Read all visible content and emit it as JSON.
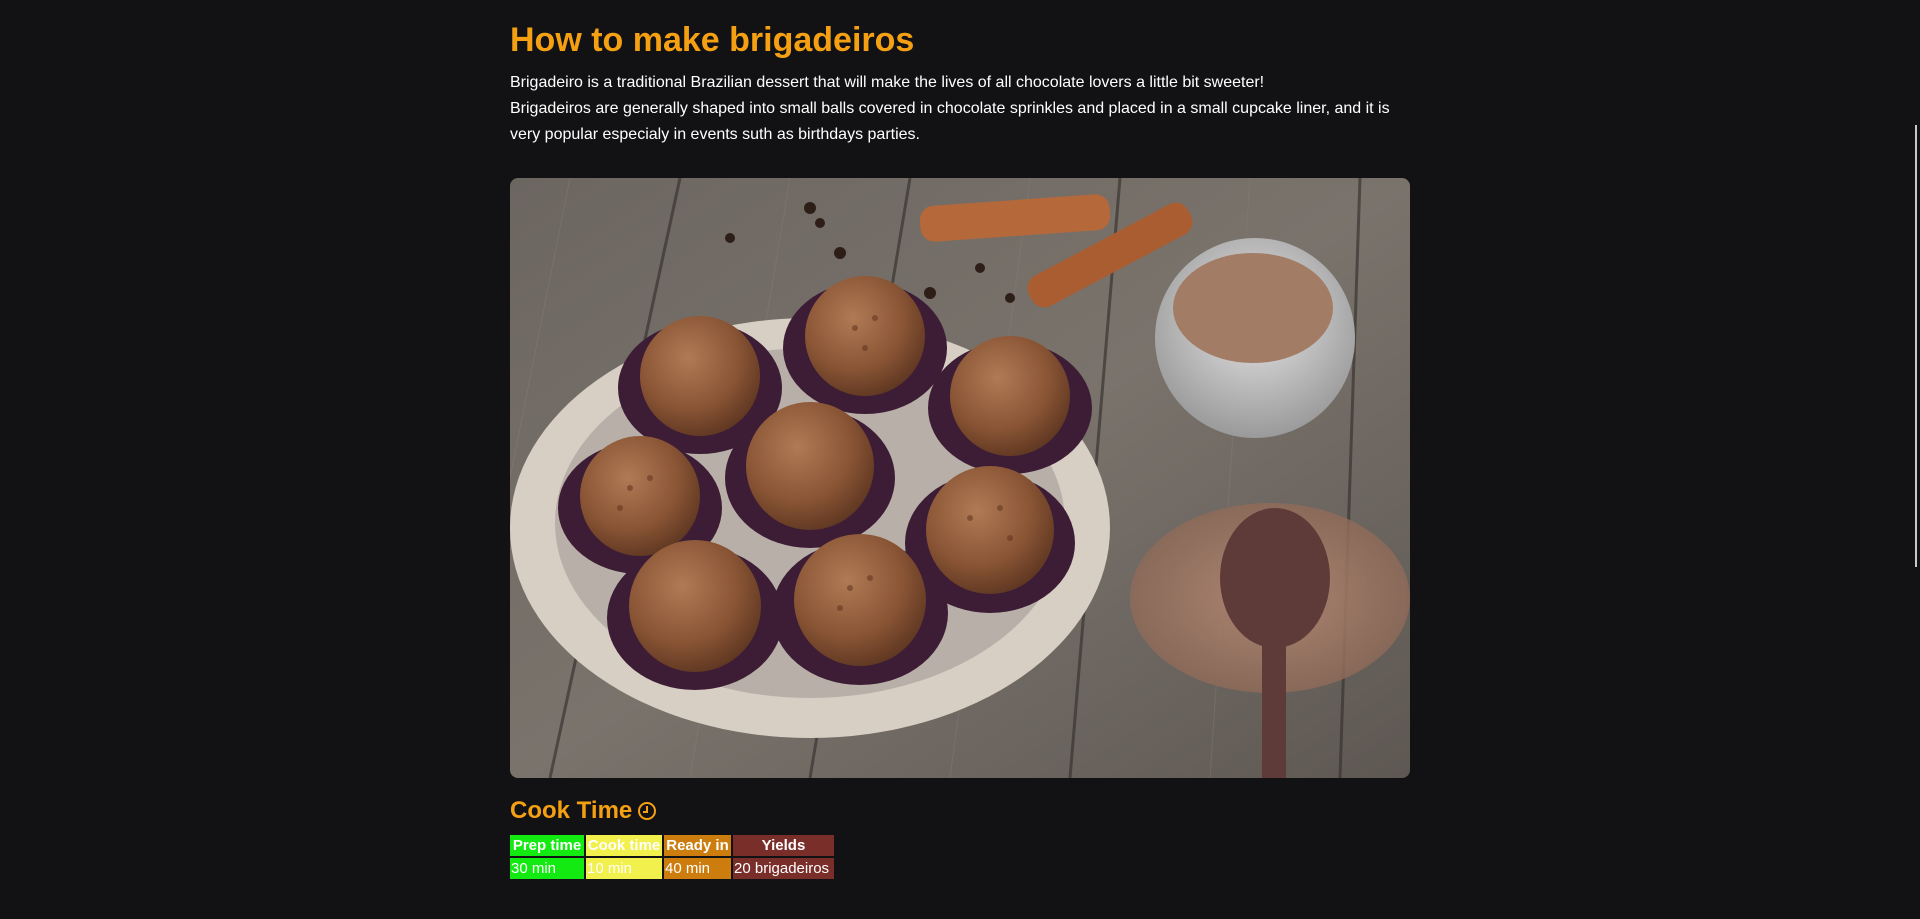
{
  "recipe": {
    "title": "How to make brigadeiros",
    "intro_line1": "Brigadeiro is a traditional Brazilian dessert that will make the lives of all chocolate lovers a little bit sweeter!",
    "intro_line2": "Brigadeiros are generally shaped into small balls covered in chocolate sprinkles and placed in a small cupcake liner, and it is very popular especialy in events suth as birthdays parties."
  },
  "cook_time": {
    "heading": "Cook Time",
    "headers": [
      "Prep time",
      "Cook time",
      "Ready in",
      "Yields"
    ],
    "values": [
      "30 min",
      "10 min",
      "40 min",
      "20 brigadeiros"
    ]
  },
  "colors": {
    "accent": "#f5a012",
    "prep": "#13ea12",
    "cook": "#f1f04c",
    "ready": "#cd7d0e",
    "yields": "#7a2e2a",
    "background": "#121214"
  },
  "icons": {
    "heading_icon": "clock-icon"
  }
}
